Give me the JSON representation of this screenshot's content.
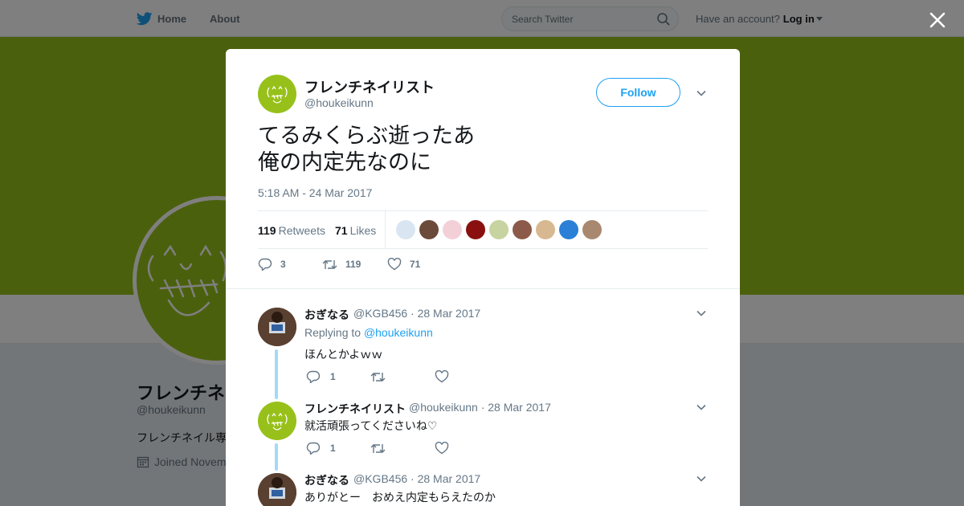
{
  "nav": {
    "home_label": "Home",
    "about_label": "About",
    "search_placeholder": "Search Twitter",
    "account_prompt": "Have an account?",
    "login_label": "Log in"
  },
  "background_profile": {
    "name_partial": "フレンチネ",
    "handle": "@houkeikunn",
    "bio_partial": "フレンチネイル専",
    "joined_partial": "Joined Novem"
  },
  "tweet": {
    "author_name": "フレンチネイリスト",
    "author_handle": "@houkeikunn",
    "follow_label": "Follow",
    "text_line1": "てるみくらぶ逝ったあ",
    "text_line2": "俺の内定先なのに",
    "timestamp": "5:18 AM - 24 Mar 2017",
    "retweets_count": "119",
    "retweets_label": "Retweets",
    "likes_count": "71",
    "likes_label": "Likes",
    "reply_count": "3",
    "retweet_count": "119",
    "like_count": "71",
    "liker_colors": [
      "#d9e6f2",
      "#6b4a3a",
      "#f3d0d8",
      "#8a1010",
      "#c7d3a0",
      "#8c5a4a",
      "#d8b890",
      "#2b7fd6",
      "#a98870"
    ]
  },
  "replies": [
    {
      "name": "おぎなる",
      "handle": "@KGB456",
      "date": "· 28 Mar 2017",
      "replying_prefix": "Replying to",
      "replying_to": "@houkeikunn",
      "text": "ほんとかよｗｗ",
      "reply_count": "1"
    },
    {
      "name": "フレンチネイリスト",
      "handle": "@houkeikunn",
      "date": "· 28 Mar 2017",
      "text": "就活頑張ってくださいね♡",
      "reply_count": "1"
    },
    {
      "name": "おぎなる",
      "handle": "@KGB456",
      "date": "· 28 Mar 2017",
      "text": "ありがとー　おめえ内定もらえたのか"
    }
  ],
  "colors": {
    "brand_blue": "#1da1f2",
    "banner_green": "#97c11a",
    "thread_line": "#a4d9f9"
  }
}
